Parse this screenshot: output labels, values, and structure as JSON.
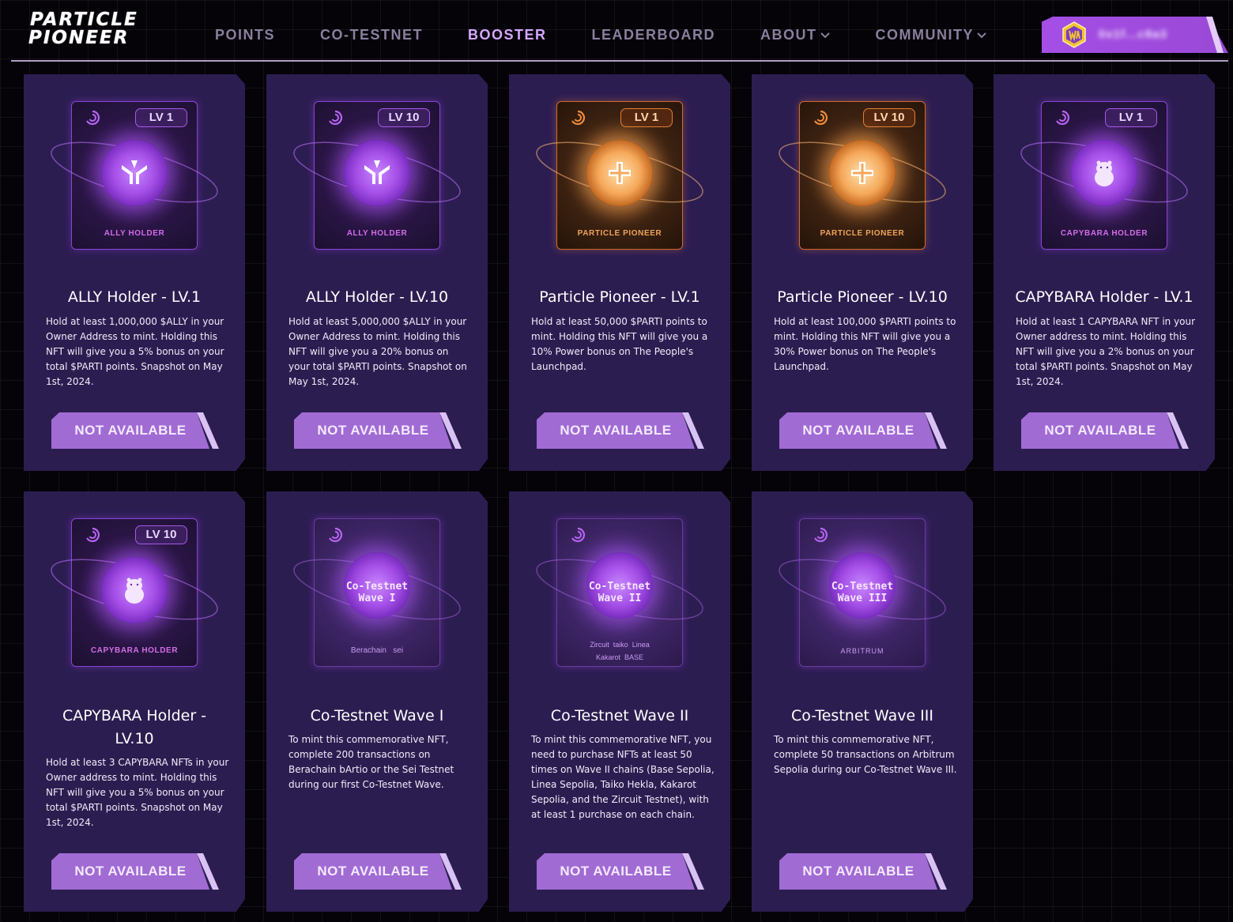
{
  "brand": {
    "line1": "PARTICLE",
    "line2": "PIONEER"
  },
  "nav": [
    {
      "label": "POINTS",
      "active": false,
      "dropdown": false
    },
    {
      "label": "CO-TESTNET",
      "active": false,
      "dropdown": false
    },
    {
      "label": "BOOSTER",
      "active": true,
      "dropdown": false
    },
    {
      "label": "LEADERBOARD",
      "active": false,
      "dropdown": false
    },
    {
      "label": "ABOUT",
      "active": false,
      "dropdown": true
    },
    {
      "label": "COMMUNITY",
      "active": false,
      "dropdown": true
    }
  ],
  "wallet": {
    "address": "0x1f...c8a3"
  },
  "colors": {
    "card_bg": "#2c1d51",
    "button": "#a16bd4",
    "accent": "#d6a8ff",
    "orange": "#e27f33"
  },
  "cards": [
    {
      "badge": "LV 1",
      "nft_label": "ALLY HOLDER",
      "title": "ALLY Holder - LV.1",
      "desc": "Hold at least 1,000,000 $ALLY in your Owner Address to mint. Holding this NFT will give you a 5% bonus on your total $PARTI points. Snapshot on May 1st, 2024.",
      "button": "NOT AVAILABLE"
    },
    {
      "badge": "LV 10",
      "nft_label": "ALLY HOLDER",
      "title": "ALLY Holder - LV.10",
      "desc": "Hold at least 5,000,000 $ALLY in your Owner Address to mint. Holding this NFT will give you a 20% bonus on your total $PARTI points. Snapshot on May 1st, 2024.",
      "button": "NOT AVAILABLE"
    },
    {
      "badge": "LV 1",
      "nft_label": "PARTICLE PIONEER",
      "title": "Particle Pioneer - LV.1",
      "desc": "Hold at least 50,000 $PARTI points to mint. Holding this NFT will give you a 10% Power bonus on The People's Launchpad.",
      "button": "NOT AVAILABLE"
    },
    {
      "badge": "LV 10",
      "nft_label": "PARTICLE PIONEER",
      "title": "Particle Pioneer - LV.10",
      "desc": "Hold at least 100,000 $PARTI points to mint. Holding this NFT will give you a 30% Power bonus on The People's Launchpad.",
      "button": "NOT AVAILABLE"
    },
    {
      "badge": "LV 1",
      "nft_label": "CAPYBARA HOLDER",
      "title": "CAPYBARA Holder - LV.1",
      "desc": "Hold at least 1 CAPYBARA NFT in your Owner address to mint. Holding this NFT will give you a 2% bonus on your total $PARTI points. Snapshot on May 1st, 2024.",
      "button": "NOT AVAILABLE"
    },
    {
      "badge": "LV 10",
      "nft_label": "CAPYBARA HOLDER",
      "title": "CAPYBARA Holder - LV.10",
      "desc": "Hold at least 3 CAPYBARA NFTs in your Owner address to mint. Holding this NFT will give you a 5% bonus on your total $PARTI points. Snapshot on May 1st, 2024.",
      "button": "NOT AVAILABLE"
    },
    {
      "wave_title": "Co-Testnet\nWave I",
      "wave_foot": [
        "Berachain",
        "sei"
      ],
      "title": "Co-Testnet Wave I",
      "desc": "To mint this commemorative NFT, complete 200 transactions on Berachain bArtio or the Sei Testnet during our first Co-Testnet Wave.",
      "button": "NOT AVAILABLE"
    },
    {
      "wave_title": "Co-Testnet\nWave II",
      "wave_foot": [
        "Zircuit",
        "taiko",
        "Linea",
        "Kakarot",
        "BASE"
      ],
      "title": "Co-Testnet Wave II",
      "desc": "To mint this commemorative NFT, you need to purchase NFTs at least 50 times on Wave II chains (Base Sepolia, Linea Sepolia, Taiko Hekla, Kakarot Sepolia, and the Zircuit Testnet), with at least 1 purchase on each chain.",
      "button": "NOT AVAILABLE"
    },
    {
      "wave_title": "Co-Testnet\nWave III",
      "wave_foot": [
        "ARBITRUM"
      ],
      "title": "Co-Testnet Wave III",
      "desc": "To mint this commemorative NFT, complete 50 transactions on Arbitrum Sepolia during our Co-Testnet Wave III.",
      "button": "NOT AVAILABLE"
    }
  ]
}
